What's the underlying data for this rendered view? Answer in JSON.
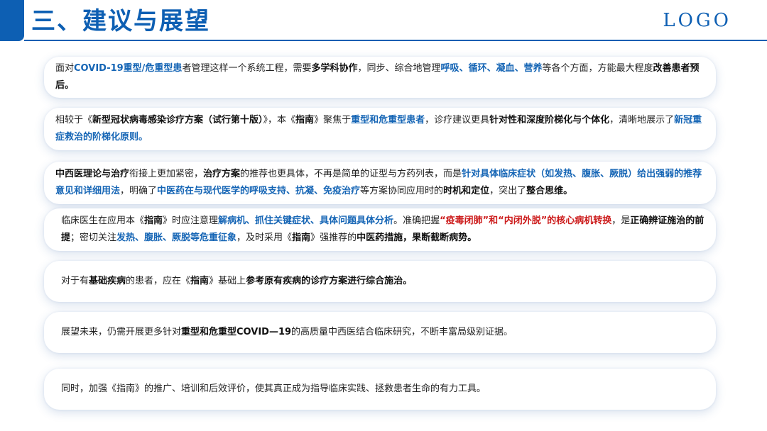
{
  "header": {
    "title": "三、建议与展望",
    "logo": "LOGO"
  },
  "colors": {
    "primary": "#0d5fb3",
    "highlight_blue": "#1565b5",
    "highlight_red": "#cc1a1a"
  },
  "cards": [
    {
      "segments": [
        {
          "text": "面对",
          "style": "normal"
        },
        {
          "text": "COVID-19重型/危重型患",
          "style": "blue"
        },
        {
          "text": "者管理这样一个系统工程，需要",
          "style": "normal"
        },
        {
          "text": "多学科协作",
          "style": "bold"
        },
        {
          "text": "，同步、综合地管理",
          "style": "normal"
        },
        {
          "text": "呼吸、循环、凝血、营养",
          "style": "blue"
        },
        {
          "text": "等各个方面，方能最大程度",
          "style": "normal"
        },
        {
          "text": "改善患者预后。",
          "style": "bold"
        }
      ]
    },
    {
      "segments": [
        {
          "text": "相较于《",
          "style": "normal"
        },
        {
          "text": "新型冠状病毒感染诊疗方案（试行第十版）",
          "style": "bold"
        },
        {
          "text": "》，本《",
          "style": "normal"
        },
        {
          "text": "指南",
          "style": "bold"
        },
        {
          "text": "》聚焦于",
          "style": "normal"
        },
        {
          "text": "重型和危重型患者",
          "style": "blue"
        },
        {
          "text": "，诊疗建议更具",
          "style": "normal"
        },
        {
          "text": "针对性和深度阶梯化与个体化",
          "style": "bold"
        },
        {
          "text": "，清晰地展示了",
          "style": "normal"
        },
        {
          "text": "新冠重症救治的阶梯化原则。",
          "style": "blue"
        }
      ]
    },
    {
      "segments": [
        {
          "text": "中西医理论与治疗",
          "style": "bold"
        },
        {
          "text": "衔接上更加紧密，",
          "style": "normal"
        },
        {
          "text": "治疗方案",
          "style": "bold"
        },
        {
          "text": "的推荐也更具体，不再是简单的证型与方药列表，而是",
          "style": "normal"
        },
        {
          "text": "针对具体临床症状（如发热、腹胀、厥脱）给出强弱的推荐意见和详细用法",
          "style": "blue"
        },
        {
          "text": "，明确了",
          "style": "normal"
        },
        {
          "text": "中医药在与现代医学的呼吸支持、抗凝、免疫治疗",
          "style": "blue"
        },
        {
          "text": "等方案协同应用时的",
          "style": "normal"
        },
        {
          "text": "时机和定位",
          "style": "bold"
        },
        {
          "text": "，突出了",
          "style": "normal"
        },
        {
          "text": "整合思维。",
          "style": "bold"
        }
      ]
    },
    {
      "segments": [
        {
          "text": "临床医生在应用本《",
          "style": "normal"
        },
        {
          "text": "指南",
          "style": "bold"
        },
        {
          "text": "》时应注意理",
          "style": "normal"
        },
        {
          "text": "解病机、抓住关键症状、具体问题具体分析",
          "style": "blue"
        },
        {
          "text": "。准确把握",
          "style": "normal"
        },
        {
          "text": "“疫毒闭肺”和“内闭外脱”的核心病机转换",
          "style": "red"
        },
        {
          "text": "，是",
          "style": "normal"
        },
        {
          "text": "正确辨证施治的前提",
          "style": "bold"
        },
        {
          "text": "；密切关注",
          "style": "normal"
        },
        {
          "text": "发热、腹胀、厥脱等危重征象",
          "style": "blue"
        },
        {
          "text": "，及时采用《",
          "style": "normal"
        },
        {
          "text": "指南",
          "style": "bold"
        },
        {
          "text": "》强推荐的",
          "style": "normal"
        },
        {
          "text": "中医药措施，果断截断病势。",
          "style": "bold"
        }
      ]
    },
    {
      "segments": [
        {
          "text": "对于有",
          "style": "normal"
        },
        {
          "text": "基础疾病",
          "style": "bold"
        },
        {
          "text": "的患者，应在《",
          "style": "normal"
        },
        {
          "text": "指南",
          "style": "bold"
        },
        {
          "text": "》基础上",
          "style": "normal"
        },
        {
          "text": "参考原有疾病的诊疗方案进行综合施治。",
          "style": "bold"
        }
      ]
    },
    {
      "segments": [
        {
          "text": "展望未来，仍需开展更多针对",
          "style": "normal"
        },
        {
          "text": "重型和危重型COVID—19",
          "style": "bold"
        },
        {
          "text": "的高质量中西医结合临床研究，不断丰富局级别证据。",
          "style": "normal"
        }
      ]
    },
    {
      "segments": [
        {
          "text": "同时，加强《指南》的推广、培训和后效评价，使其真正成为指导临床实践、拯救患者生命的有力工具。",
          "style": "normal"
        }
      ]
    }
  ]
}
